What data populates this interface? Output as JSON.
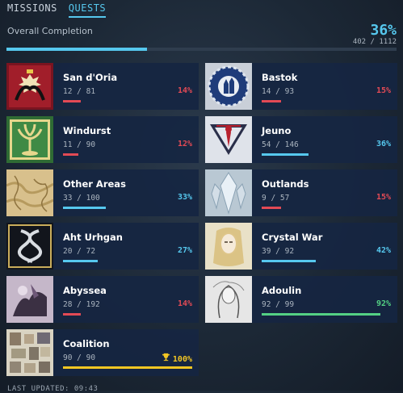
{
  "tabs": [
    {
      "label": "MISSIONS",
      "active": false
    },
    {
      "label": "QUESTS",
      "active": true
    }
  ],
  "overall": {
    "label": "Overall Completion",
    "percent_text": "36%",
    "count_text": "402 / 1112",
    "fraction": 0.36
  },
  "regions": [
    {
      "name": "San d'Oria",
      "count": "12 / 81",
      "pct": "14%",
      "progress": 0.14,
      "status": "red",
      "icon": "san-doria-crest-icon"
    },
    {
      "name": "Bastok",
      "count": "14 / 93",
      "pct": "15%",
      "progress": 0.15,
      "status": "red",
      "icon": "bastok-gear-crest-icon"
    },
    {
      "name": "Windurst",
      "count": "11 / 90",
      "pct": "12%",
      "progress": 0.12,
      "status": "red",
      "icon": "windurst-tree-crest-icon"
    },
    {
      "name": "Jeuno",
      "count": "54 / 146",
      "pct": "36%",
      "progress": 0.36,
      "status": "blue",
      "icon": "jeuno-emblem-icon"
    },
    {
      "name": "Other Areas",
      "count": "33 / 100",
      "pct": "33%",
      "progress": 0.33,
      "status": "blue",
      "icon": "map-icon"
    },
    {
      "name": "Outlands",
      "count": "9 / 57",
      "pct": "15%",
      "progress": 0.15,
      "status": "red",
      "icon": "outlands-crystal-icon"
    },
    {
      "name": "Aht Urhgan",
      "count": "20 / 72",
      "pct": "27%",
      "progress": 0.27,
      "status": "blue",
      "icon": "aht-urhgan-serpent-icon"
    },
    {
      "name": "Crystal War",
      "count": "39 / 92",
      "pct": "42%",
      "progress": 0.42,
      "status": "blue",
      "icon": "crystal-war-portrait-icon"
    },
    {
      "name": "Abyssea",
      "count": "28 / 192",
      "pct": "14%",
      "progress": 0.14,
      "status": "red",
      "icon": "abyssea-art-icon"
    },
    {
      "name": "Adoulin",
      "count": "92 / 99",
      "pct": "92%",
      "progress": 0.92,
      "status": "green",
      "icon": "adoulin-sketch-icon"
    },
    {
      "name": "Coalition",
      "count": "90 / 90",
      "pct": "100%",
      "progress": 1.0,
      "status": "gold",
      "icon": "coalition-collage-icon",
      "complete": true
    }
  ],
  "footer": "LAST UPDATED: 09:43",
  "colors": {
    "red": "#e24a55",
    "blue": "#56c8ee",
    "green": "#54d184",
    "gold": "#f3c623",
    "card": "#152642"
  }
}
